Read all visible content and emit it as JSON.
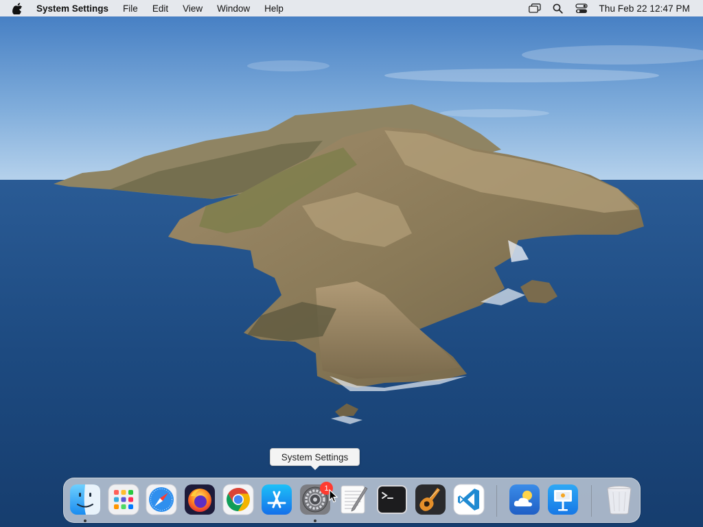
{
  "menubar": {
    "app_name": "System Settings",
    "menus": [
      "File",
      "Edit",
      "View",
      "Window",
      "Help"
    ],
    "clock": "Thu Feb 22  12:47 PM",
    "status_icons": [
      "screen-mirroring-icon",
      "spotlight-search-icon",
      "control-center-icon"
    ]
  },
  "tooltip": {
    "label": "System Settings"
  },
  "dock": {
    "apps": [
      {
        "name": "Finder",
        "icon": "finder-icon",
        "running": true
      },
      {
        "name": "Launchpad",
        "icon": "launchpad-icon",
        "running": false
      },
      {
        "name": "Safari",
        "icon": "safari-icon",
        "running": false
      },
      {
        "name": "Firefox",
        "icon": "firefox-icon",
        "running": false
      },
      {
        "name": "Chrome",
        "icon": "chrome-icon",
        "running": false
      },
      {
        "name": "App Store",
        "icon": "app-store-icon",
        "running": false
      },
      {
        "name": "System Settings",
        "icon": "system-settings-icon",
        "running": true,
        "badge": "1"
      },
      {
        "name": "TextEdit",
        "icon": "textedit-icon",
        "running": false
      },
      {
        "name": "Terminal",
        "icon": "terminal-icon",
        "running": false
      },
      {
        "name": "GarageBand",
        "icon": "garageband-icon",
        "running": false
      },
      {
        "name": "Visual Studio Code",
        "icon": "vscode-icon",
        "running": false
      },
      {
        "name": "Weather",
        "icon": "weather-icon",
        "running": false
      },
      {
        "name": "Keynote",
        "icon": "keynote-icon",
        "running": false
      },
      {
        "name": "Trash",
        "icon": "trash-icon",
        "running": false
      }
    ]
  },
  "colors": {
    "menubar_bg": "#ececee",
    "badge": "#ff3b30",
    "sky_top": "#3f7cc4",
    "sea": "#1d4a80"
  }
}
